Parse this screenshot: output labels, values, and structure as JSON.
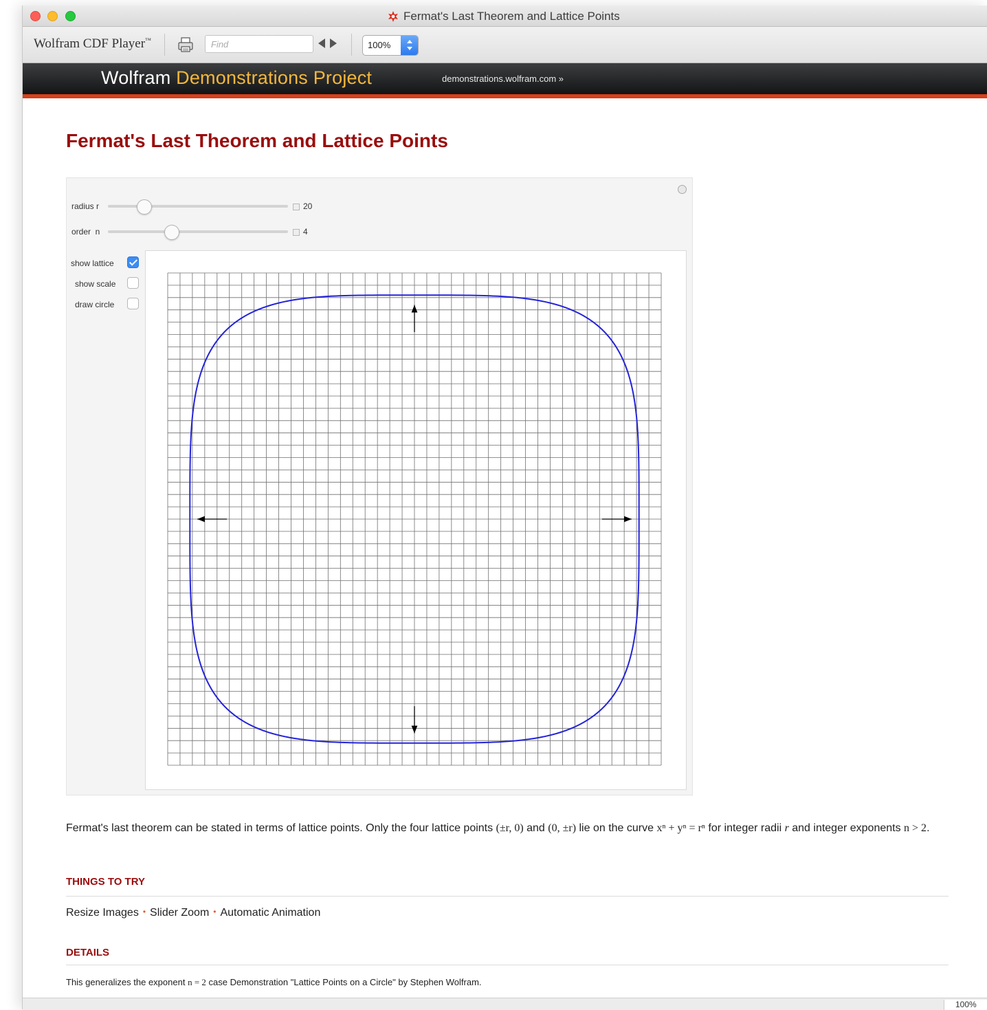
{
  "window": {
    "title": "Fermat's Last Theorem and Lattice Points"
  },
  "toolbar": {
    "player_name": "Wolfram CDF Player",
    "player_mark": "™",
    "find_placeholder": "Find",
    "zoom": "100%"
  },
  "banner": {
    "brand_first": "Wolfram",
    "brand_second": "Demonstrations Project",
    "site_link": "demonstrations.wolfram.com »"
  },
  "demo": {
    "title": "Fermat's Last Theorem and Lattice Points",
    "controls": {
      "radius": {
        "label": "radius r",
        "value": "20",
        "fraction": 0.2
      },
      "order": {
        "label": "order  n",
        "value": "4",
        "fraction": 0.35
      },
      "show_lattice": {
        "label": "show lattice",
        "checked": true
      },
      "show_scale": {
        "label": "show scale",
        "checked": false
      },
      "draw_circle": {
        "label": "draw circle",
        "checked": false
      }
    },
    "plot": {
      "grid_range": [
        -20,
        20
      ],
      "curve_radius": 18.2,
      "curve_exponent": 4,
      "curve_color": "#2323d8",
      "grid_color": "#6f6f6f"
    }
  },
  "description": {
    "p1": "Fermat's last theorem can be stated in terms of lattice points. Only the four lattice points ",
    "m1": "(±r, 0)",
    "p2": " and ",
    "m2": "(0, ±r)",
    "p3": " lie on the curve ",
    "m3": "xⁿ + yⁿ = rⁿ",
    "p4": " for integer radii ",
    "m4": "r",
    "p5": " and integer exponents ",
    "m5": "n > 2",
    "p6": "."
  },
  "things_to_try": {
    "heading": "THINGS TO TRY",
    "links": [
      "Resize Images",
      "Slider Zoom",
      "Automatic Animation"
    ]
  },
  "details": {
    "heading": "DETAILS",
    "t1": "This generalizes the exponent ",
    "m1": "n = 2",
    "t2": " case Demonstration \"Lattice Points on a Circle\" by Stephen Wolfram."
  },
  "status": {
    "zoom": "100%"
  }
}
